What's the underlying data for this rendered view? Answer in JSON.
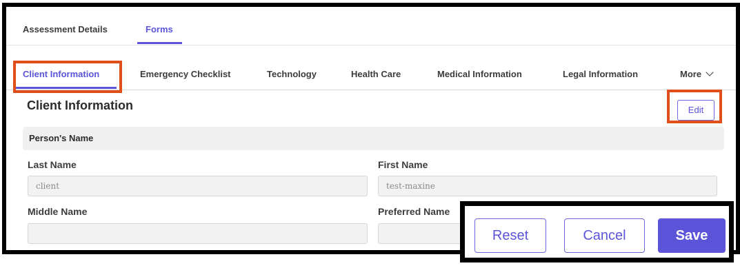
{
  "top_tabs": [
    {
      "label": "Assessment Details"
    },
    {
      "label": "Forms"
    }
  ],
  "sub_tabs": [
    {
      "label": "Client Information"
    },
    {
      "label": "Emergency Checklist"
    },
    {
      "label": "Technology"
    },
    {
      "label": "Health Care"
    },
    {
      "label": "Medical Information"
    },
    {
      "label": "Legal Information"
    },
    {
      "label": "More"
    }
  ],
  "section": {
    "title": "Client Information",
    "edit_label": "Edit",
    "group_title": "Person's Name"
  },
  "fields": {
    "last_name": {
      "label": "Last Name",
      "value": "client"
    },
    "first_name": {
      "label": "First Name",
      "value": "test-maxine"
    },
    "middle_name": {
      "label": "Middle Name",
      "value": ""
    },
    "preferred_name": {
      "label": "Preferred Name",
      "value": ""
    }
  },
  "actions": {
    "reset": "Reset",
    "cancel": "Cancel",
    "save": "Save"
  },
  "colors": {
    "accent": "#5b54d9",
    "highlight": "#e04e1a"
  }
}
